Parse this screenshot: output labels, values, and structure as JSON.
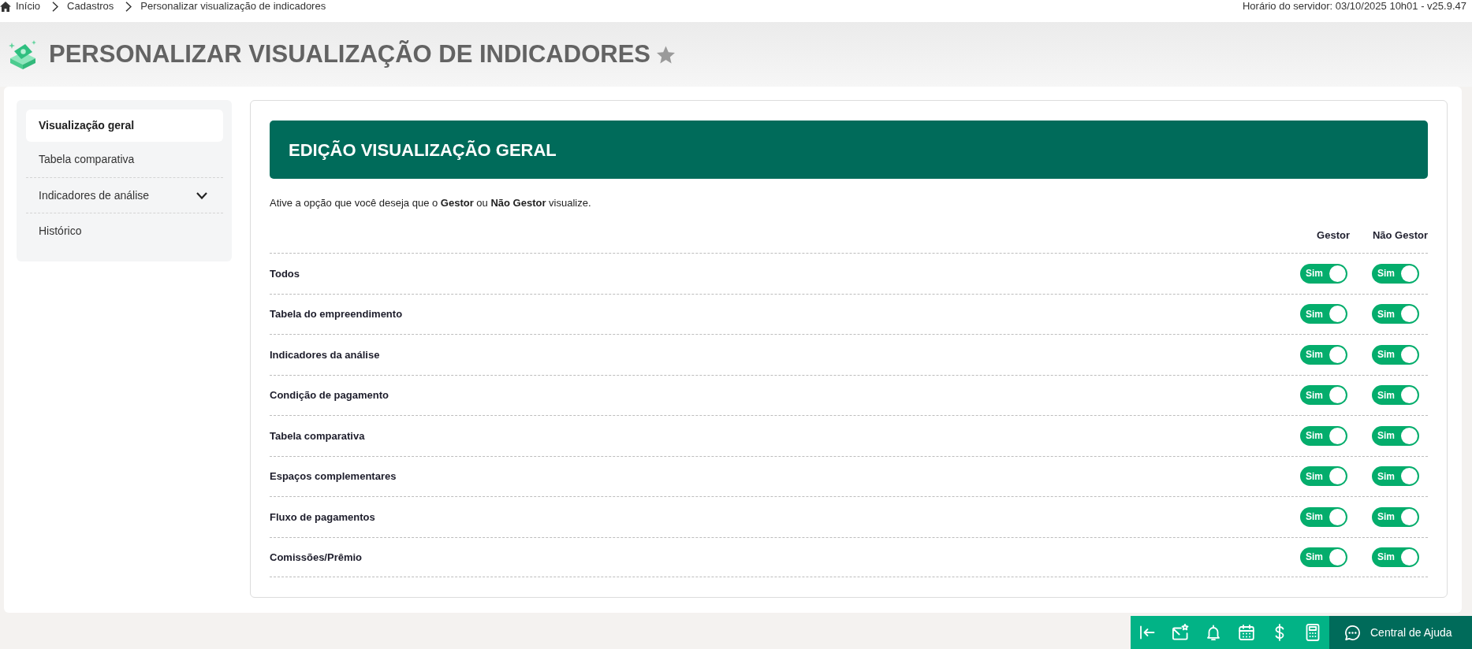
{
  "breadcrumb": [
    {
      "label": "Início"
    },
    {
      "label": "Cadastros"
    },
    {
      "label": "Personalizar visualização de indicadores"
    }
  ],
  "server_info": "Horário do servidor: 03/10/2025 10h01 - v25.9.47",
  "header": {
    "title": "PERSONALIZAR VISUALIZAÇÃO DE INDICADORES",
    "favorite": false
  },
  "sidebar": {
    "items": [
      {
        "label": "Visualização geral",
        "kind": "link",
        "selected": true
      },
      {
        "label": "Tabela comparativa",
        "kind": "link",
        "selected": false
      },
      {
        "label": "Indicadores de análise",
        "kind": "group",
        "selected": false,
        "expanded": false
      },
      {
        "label": "Histórico",
        "kind": "link",
        "selected": false
      }
    ]
  },
  "panel": {
    "title": "EDIÇÃO VISUALIZAÇÃO GERAL",
    "instruction": "Ative a opção que você deseja que o **Gestor** ou **Não Gestor** visualize.",
    "columns": [
      "Gestor",
      "Não Gestor"
    ],
    "rows": [
      {
        "label": "Todos",
        "toggles": [
          {
            "text": "Sim",
            "on": true
          },
          {
            "text": "Sim",
            "on": true
          }
        ]
      },
      {
        "label": "Tabela do empreendimento",
        "toggles": [
          {
            "text": "Sim",
            "on": true
          },
          {
            "text": "Sim",
            "on": true
          }
        ]
      },
      {
        "label": "Indicadores da análise",
        "toggles": [
          {
            "text": "Sim",
            "on": true
          },
          {
            "text": "Sim",
            "on": true
          }
        ]
      },
      {
        "label": "Condição de pagamento",
        "toggles": [
          {
            "text": "Sim",
            "on": true
          },
          {
            "text": "Sim",
            "on": true
          }
        ]
      },
      {
        "label": "Tabela comparativa",
        "toggles": [
          {
            "text": "Sim",
            "on": true
          },
          {
            "text": "Sim",
            "on": true
          }
        ]
      },
      {
        "label": "Espaços complementares",
        "toggles": [
          {
            "text": "Sim",
            "on": true
          },
          {
            "text": "Sim",
            "on": true
          }
        ]
      },
      {
        "label": "Fluxo de pagamentos",
        "toggles": [
          {
            "text": "Sim",
            "on": true
          },
          {
            "text": "Sim",
            "on": true
          }
        ]
      },
      {
        "label": "Comissões/Prêmio",
        "toggles": [
          {
            "text": "Sim",
            "on": true
          },
          {
            "text": "Sim",
            "on": true
          }
        ]
      }
    ]
  },
  "help_button": {
    "label": "Central de Ajuda"
  }
}
